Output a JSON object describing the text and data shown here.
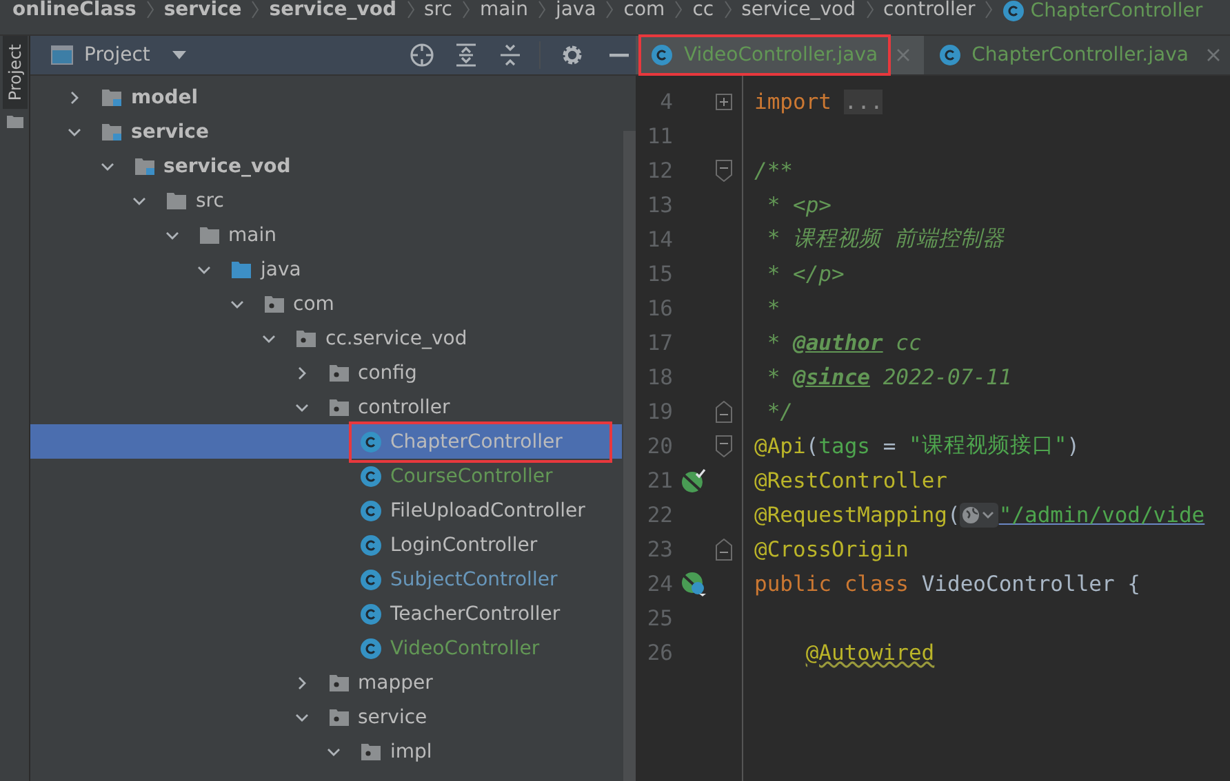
{
  "breadcrumb": [
    {
      "label": "onlineClass",
      "kind": "module"
    },
    {
      "label": "service",
      "kind": "module"
    },
    {
      "label": "service_vod",
      "kind": "module"
    },
    {
      "label": "src",
      "kind": "folder"
    },
    {
      "label": "main",
      "kind": "folder"
    },
    {
      "label": "java",
      "kind": "folder"
    },
    {
      "label": "com",
      "kind": "folder"
    },
    {
      "label": "cc",
      "kind": "folder"
    },
    {
      "label": "service_vod",
      "kind": "folder"
    },
    {
      "label": "controller",
      "kind": "folder"
    },
    {
      "label": "ChapterController",
      "kind": "class"
    }
  ],
  "side_strip": {
    "label": "Project",
    "selected": true
  },
  "project_panel": {
    "title": "Project",
    "tree": [
      {
        "label": "model",
        "kind": "module",
        "expanded": false
      },
      {
        "label": "service",
        "kind": "module",
        "expanded": true,
        "children": [
          {
            "label": "service_vod",
            "kind": "module",
            "expanded": true,
            "children": [
              {
                "label": "src",
                "kind": "folder",
                "expanded": true,
                "children": [
                  {
                    "label": "main",
                    "kind": "folder",
                    "expanded": true,
                    "children": [
                      {
                        "label": "java",
                        "kind": "source",
                        "expanded": true,
                        "children": [
                          {
                            "label": "com",
                            "kind": "package",
                            "expanded": true,
                            "children": [
                              {
                                "label": "cc.service_vod",
                                "kind": "package",
                                "expanded": true,
                                "children": [
                                  {
                                    "label": "config",
                                    "kind": "package",
                                    "expanded": false
                                  },
                                  {
                                    "label": "controller",
                                    "kind": "package",
                                    "expanded": true,
                                    "children": [
                                      {
                                        "label": "ChapterController",
                                        "kind": "class",
                                        "color": "#bbbbbb",
                                        "selected": true,
                                        "highlighted": true
                                      },
                                      {
                                        "label": "CourseController",
                                        "kind": "class",
                                        "color": "#629755",
                                        "selected": false,
                                        "highlighted": false
                                      },
                                      {
                                        "label": "FileUploadController",
                                        "kind": "class",
                                        "color": "#bbbbbb",
                                        "selected": false,
                                        "highlighted": false
                                      },
                                      {
                                        "label": "LoginController",
                                        "kind": "class",
                                        "color": "#bbbbbb",
                                        "selected": false,
                                        "highlighted": false
                                      },
                                      {
                                        "label": "SubjectController",
                                        "kind": "class",
                                        "color": "#6897bb",
                                        "selected": false,
                                        "highlighted": false
                                      },
                                      {
                                        "label": "TeacherController",
                                        "kind": "class",
                                        "color": "#bbbbbb",
                                        "selected": false,
                                        "highlighted": false
                                      },
                                      {
                                        "label": "VideoController",
                                        "kind": "class",
                                        "color": "#629755",
                                        "selected": false,
                                        "highlighted": false
                                      }
                                    ]
                                  },
                                  {
                                    "label": "mapper",
                                    "kind": "package",
                                    "expanded": false
                                  },
                                  {
                                    "label": "service",
                                    "kind": "package",
                                    "expanded": true,
                                    "children": [
                                      {
                                        "label": "impl",
                                        "kind": "package",
                                        "expanded": true
                                      }
                                    ]
                                  }
                                ]
                              }
                            ]
                          }
                        ]
                      }
                    ]
                  }
                ]
              }
            ]
          }
        ]
      }
    ]
  },
  "editor": {
    "tabs": [
      {
        "label": "VideoController.java",
        "selected": true,
        "highlighted": true
      },
      {
        "label": "ChapterController.java",
        "selected": false,
        "highlighted": false
      }
    ],
    "lines": [
      {
        "n": "4",
        "fold": {
          "kind": "collapsed"
        },
        "tokens": [
          {
            "text": "import",
            "kind": "keyword"
          },
          {
            "text": "...",
            "kind": "folded"
          }
        ]
      },
      {
        "n": "11"
      },
      {
        "n": "12",
        "fold": {
          "kind": "start"
        },
        "tokens": [
          {
            "text": "/**",
            "kind": "doc"
          }
        ]
      },
      {
        "n": "13",
        "tokens": [
          {
            "text": " * <p>",
            "kind": "doc"
          }
        ]
      },
      {
        "n": "14",
        "tokens": [
          {
            "text": " * 课程视频 前端控制器",
            "kind": "doc"
          }
        ]
      },
      {
        "n": "15",
        "tokens": [
          {
            "text": " * </p>",
            "kind": "doc"
          }
        ]
      },
      {
        "n": "16",
        "tokens": [
          {
            "text": " *",
            "kind": "doc"
          }
        ]
      },
      {
        "n": "17",
        "tokens": [
          {
            "text": " * ",
            "kind": "doc"
          },
          {
            "text": "@author",
            "kind": "doctag"
          },
          {
            "text": " cc",
            "kind": "doc"
          }
        ]
      },
      {
        "n": "18",
        "tokens": [
          {
            "text": " * ",
            "kind": "doc"
          },
          {
            "text": "@since",
            "kind": "doctag"
          },
          {
            "text": " 2022-07-11",
            "kind": "doc"
          }
        ]
      },
      {
        "n": "19",
        "fold": {
          "kind": "end"
        },
        "tokens": [
          {
            "text": " */",
            "kind": "doc"
          }
        ]
      },
      {
        "n": "20",
        "fold": {
          "kind": "start"
        },
        "tokens": [
          {
            "text": "@Api",
            "kind": "annotation"
          },
          {
            "text": "(",
            "kind": "plain"
          },
          {
            "text": "tags",
            "kind": "param"
          },
          {
            "text": " = ",
            "kind": "plain"
          },
          {
            "text": "\"课程视频接口\"",
            "kind": "string"
          },
          {
            "text": ")",
            "kind": "plain"
          }
        ]
      },
      {
        "n": "21",
        "gutter": {
          "kind": "bean"
        },
        "tokens": [
          {
            "text": "@RestController",
            "kind": "annotation"
          }
        ]
      },
      {
        "n": "22",
        "tokens": [
          {
            "text": "@RequestMapping",
            "kind": "annotation"
          },
          {
            "text": "(",
            "kind": "plain"
          },
          {
            "kind": "inlay"
          },
          {
            "text": "\"/admin/vod/vide",
            "kind": "url"
          }
        ]
      },
      {
        "n": "23",
        "fold": {
          "kind": "end"
        },
        "tokens": [
          {
            "text": "@CrossOrigin",
            "kind": "annotation"
          }
        ]
      },
      {
        "n": "24",
        "gutter": {
          "kind": "bean-web"
        },
        "tokens": [
          {
            "text": "public",
            "kind": "keyword"
          },
          {
            "text": " class",
            "kind": "keyword"
          },
          {
            "text": " VideoController {",
            "kind": "plain"
          }
        ]
      },
      {
        "n": "25"
      },
      {
        "n": "26",
        "indented": true,
        "tokens": [
          {
            "text": "@Autowired",
            "kind": "warn"
          }
        ]
      }
    ]
  }
}
